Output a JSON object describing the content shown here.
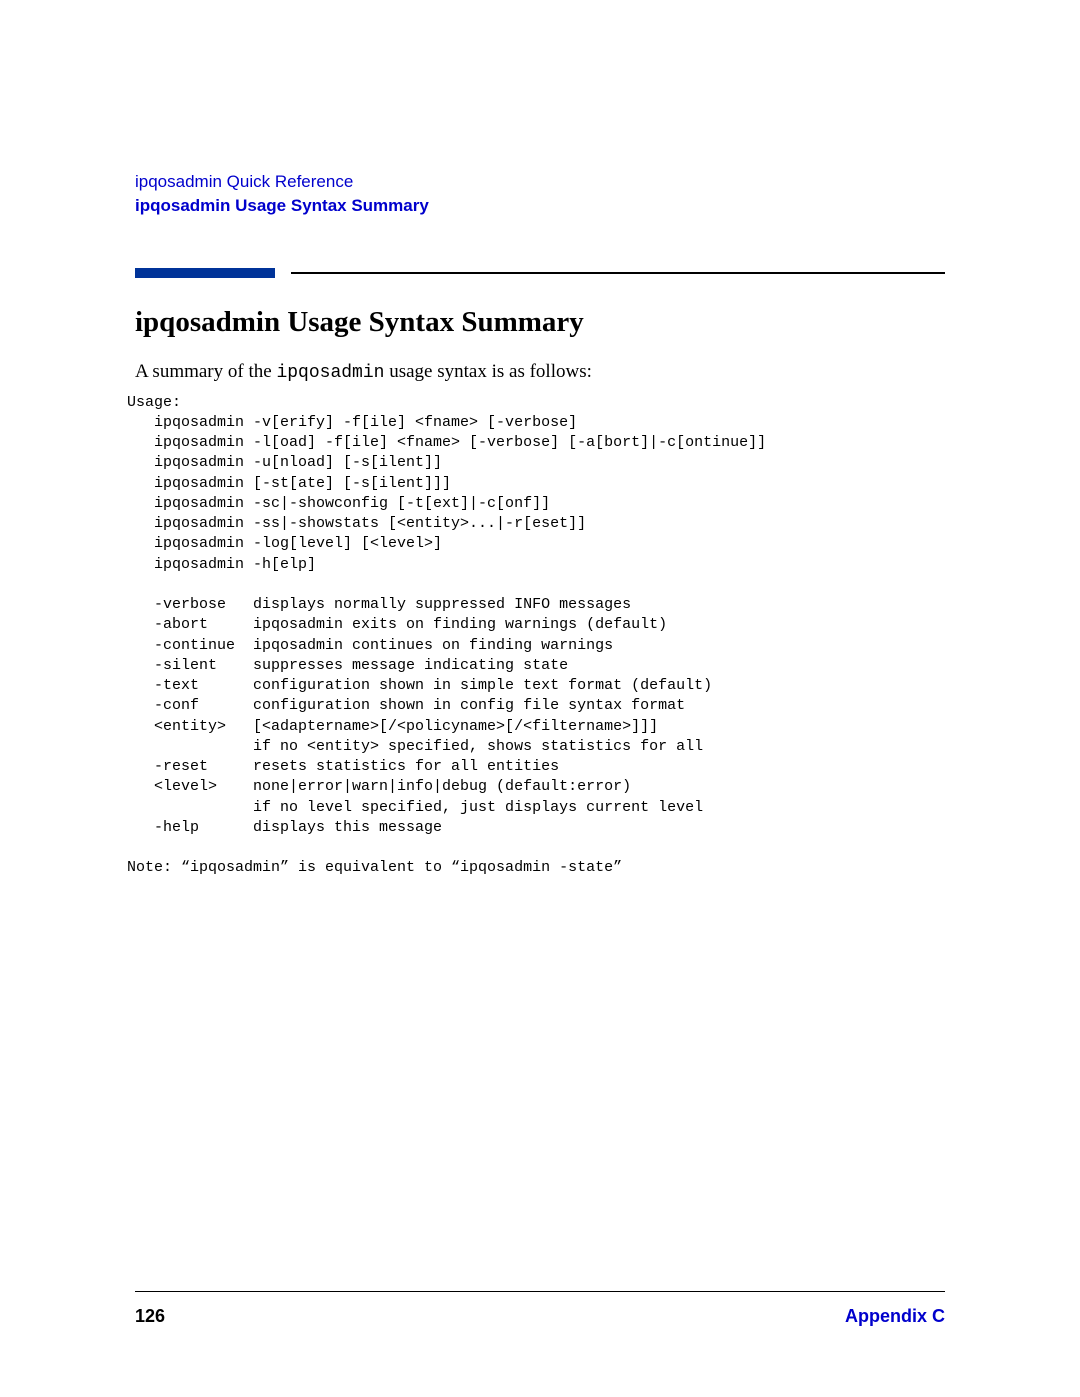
{
  "header": {
    "chapter": "ipqosadmin Quick Reference",
    "section": "ipqosadmin Usage Syntax Summary"
  },
  "title": "ipqosadmin Usage Syntax Summary",
  "intro_pre": "A summary of the ",
  "intro_cmd": "ipqosadmin",
  "intro_post": " usage syntax is as follows:",
  "usage": "Usage:\n   ipqosadmin -v[erify] -f[ile] <fname> [-verbose]\n   ipqosadmin -l[oad] -f[ile] <fname> [-verbose] [-a[bort]|-c[ontinue]]\n   ipqosadmin -u[nload] [-s[ilent]]\n   ipqosadmin [-st[ate] [-s[ilent]]]\n   ipqosadmin -sc|-showconfig [-t[ext]|-c[onf]]\n   ipqosadmin -ss|-showstats [<entity>...|-r[eset]]\n   ipqosadmin -log[level] [<level>]\n   ipqosadmin -h[elp]\n\n   -verbose   displays normally suppressed INFO messages\n   -abort     ipqosadmin exits on finding warnings (default)\n   -continue  ipqosadmin continues on finding warnings\n   -silent    suppresses message indicating state\n   -text      configuration shown in simple text format (default)\n   -conf      configuration shown in config file syntax format\n   <entity>   [<adaptername>[/<policyname>[/<filtername>]]]\n              if no <entity> specified, shows statistics for all\n   -reset     resets statistics for all entities\n   <level>    none|error|warn|info|debug (default:error)\n              if no level specified, just displays current level\n   -help      displays this message\n\nNote: “ipqosadmin” is equivalent to “ipqosadmin -state”",
  "footer": {
    "page": "126",
    "appendix": "Appendix C"
  }
}
